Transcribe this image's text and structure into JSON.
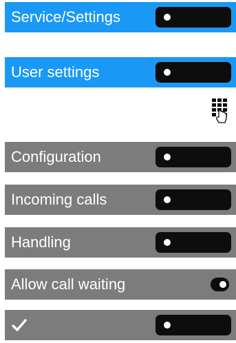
{
  "menu": {
    "service_settings": {
      "label": "Service/Settings"
    },
    "user_settings": {
      "label": "User settings"
    },
    "configuration": {
      "label": "Configuration"
    },
    "incoming_calls": {
      "label": "Incoming calls"
    },
    "handling": {
      "label": "Handling"
    },
    "allow_call_waiting": {
      "label": "Allow call waiting",
      "toggle_state": "on"
    },
    "confirm": {
      "icon": "checkmark-icon"
    }
  },
  "icons": {
    "keypad": "keypad-hand-icon",
    "checkmark": "checkmark-icon"
  },
  "colors": {
    "highlight": "#1a98f5",
    "row": "#7c7c7c",
    "key": "#0d0d0d",
    "text": "#ffffff"
  }
}
